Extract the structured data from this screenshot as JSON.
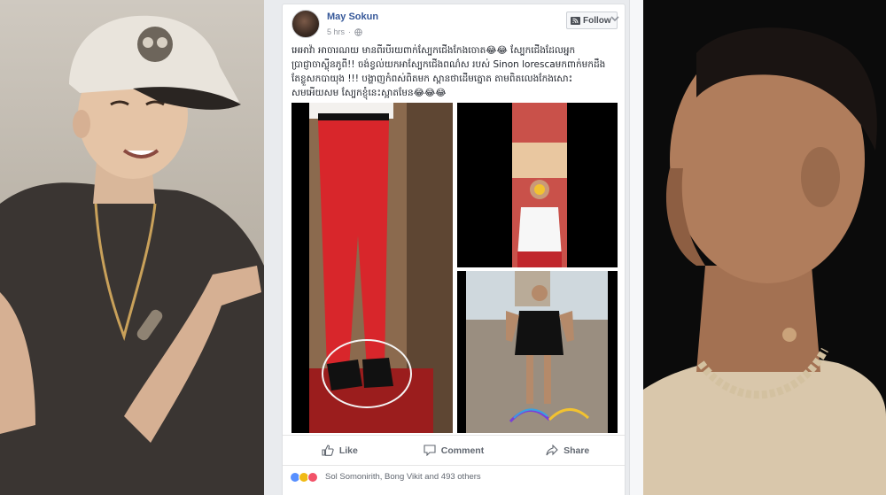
{
  "post": {
    "author": "May Sokun",
    "time": "5 hrs",
    "follow_label": "Follow",
    "text": "អេអាវ៉ា អាចារណយ មានពីរបីរយពាក់ស្បែកជើងកែងចោត😂😂 ស្បែកជើងដែលអ្នកប្រាជ្ញាចាស្លុីនភូពី!! ចង់ខ្វល់យកអាស្បែកជើងពណ៌ស របស់ Sinon lorescaមកពាក់មកដឹង តែខ្លួសកបាយុង !!! បង្ហាញកំពស់ពិតមក ស្ពានថាដើមត្នោត តាមពិតលេងកែងសោះ សមអើយសម ស្បែកខ្ញុំនេះស្អាតមែន😂😂😂"
  },
  "actions": {
    "like": "Like",
    "comment": "Comment",
    "share": "Share"
  },
  "reactions": {
    "names": "Sol Somonirith, Bong Vikit and 493 others"
  },
  "colors": {
    "link": "#365899",
    "text": "#1d2129",
    "muted": "#90949c",
    "like_blue": "#5890ff",
    "red_pants": "#d8262b"
  }
}
